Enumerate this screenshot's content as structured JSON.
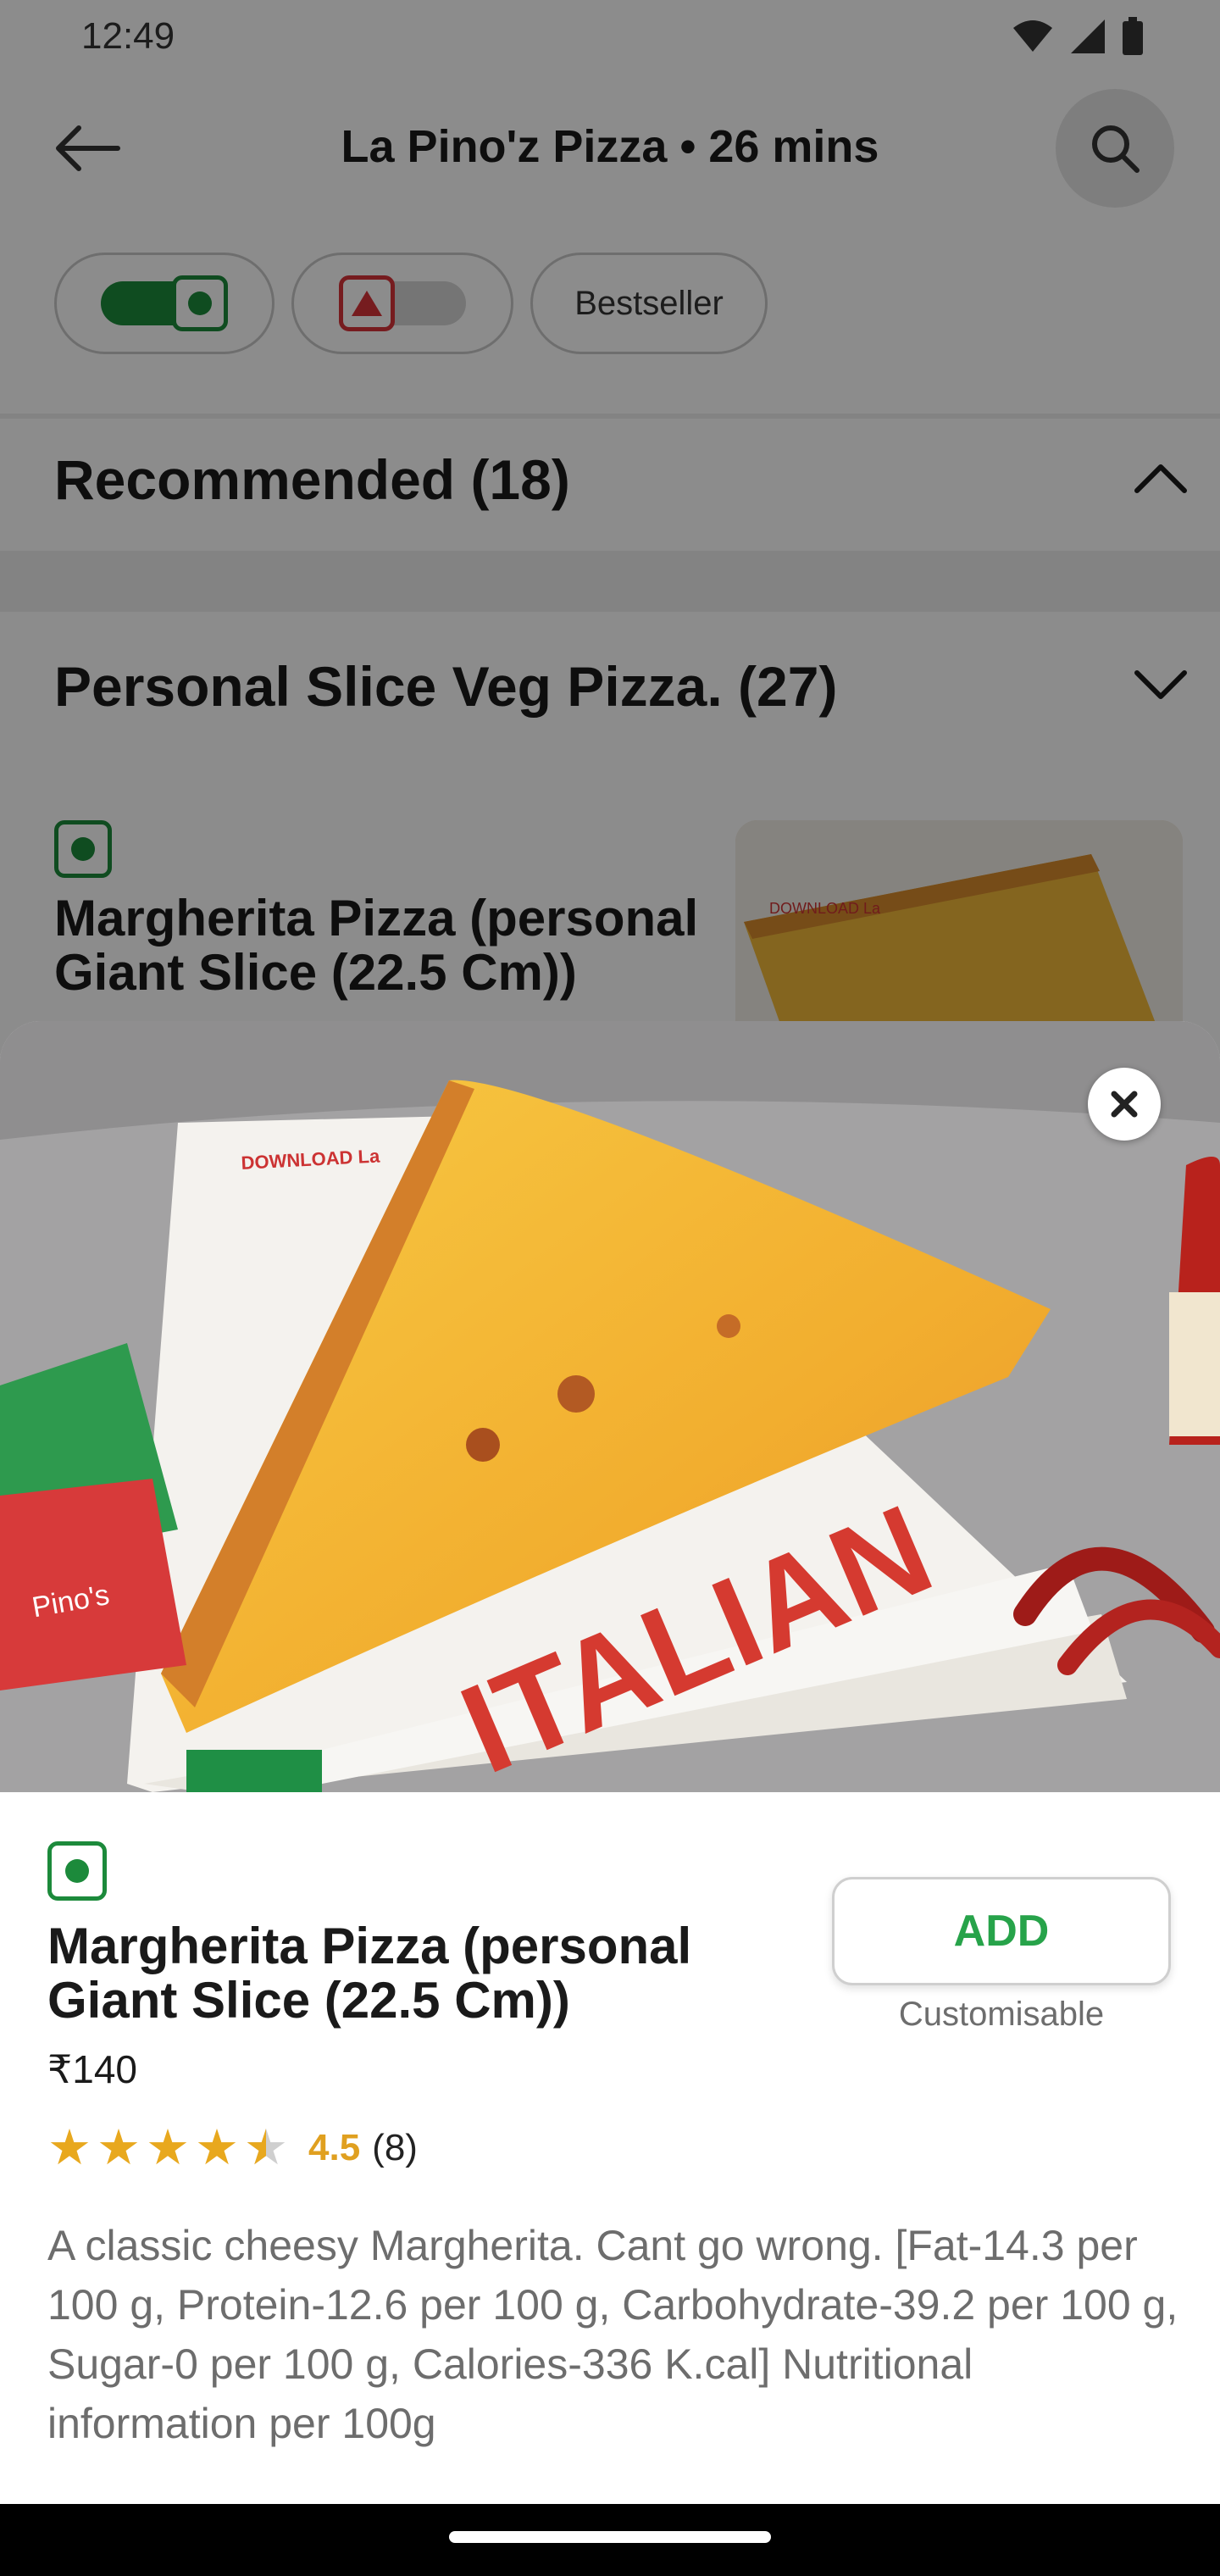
{
  "status": {
    "time": "12:49"
  },
  "header": {
    "title": "La Pino'z Pizza • 26 mins"
  },
  "filters": {
    "bestseller_label": "Bestseller"
  },
  "sections": [
    {
      "label": "Recommended (18)",
      "expanded": true
    },
    {
      "label": "Personal Slice Veg Pizza. (27)",
      "expanded": false
    }
  ],
  "background_item": {
    "name": "Margherita Pizza (personal Giant Slice (22.5 Cm))"
  },
  "item": {
    "name": "Margherita Pizza (personal Giant Slice (22.5 Cm))",
    "price": "₹140",
    "rating": "4.5",
    "rating_count": "(8)",
    "add_label": "ADD",
    "add_sub": "Customisable",
    "description": "A classic cheesy Margherita. Cant go wrong. [Fat-14.3 per 100 g, Protein-12.6 per 100 g, Carbohydrate-39.2 per 100 g, Sugar-0 per 100 g, Calories-336 K.cal] Nutritional information per 100g",
    "image_box_text": "ITALIAN",
    "image_box_small": "DOWNLOAD La"
  },
  "colors": {
    "veg": "#1c8a3b",
    "nonveg": "#d8333a",
    "add": "#27a34a",
    "star": "#e8a81e"
  },
  "icons": [
    "back-arrow-icon",
    "search-icon",
    "chevron-up-icon",
    "chevron-down-icon",
    "close-icon",
    "star-icon",
    "wifi-icon",
    "signal-icon",
    "battery-icon"
  ]
}
